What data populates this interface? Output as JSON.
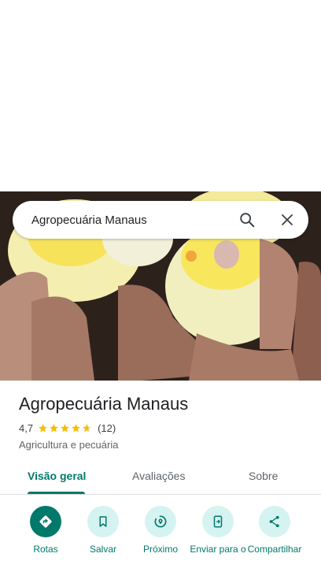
{
  "search": {
    "query": "Agropecuária Manaus"
  },
  "place": {
    "name": "Agropecuária Manaus",
    "rating": "4,7",
    "stars": 4.7,
    "review_count": "(12)",
    "category": "Agricultura e pecuária"
  },
  "tabs": [
    {
      "label": "Visão geral",
      "active": true
    },
    {
      "label": "Avaliações",
      "active": false
    },
    {
      "label": "Sobre",
      "active": false
    }
  ],
  "actions": [
    {
      "label": "Rotas",
      "icon": "directions-icon"
    },
    {
      "label": "Salvar",
      "icon": "bookmark-icon"
    },
    {
      "label": "Próximo",
      "icon": "nearby-icon"
    },
    {
      "label": "Enviar para o",
      "icon": "send-to-phone-icon"
    },
    {
      "label": "Compartilhar",
      "icon": "share-icon"
    }
  ],
  "colors": {
    "accent": "#00796b",
    "star": "#fbbc04",
    "chip_bg": "#d5f3f1"
  }
}
